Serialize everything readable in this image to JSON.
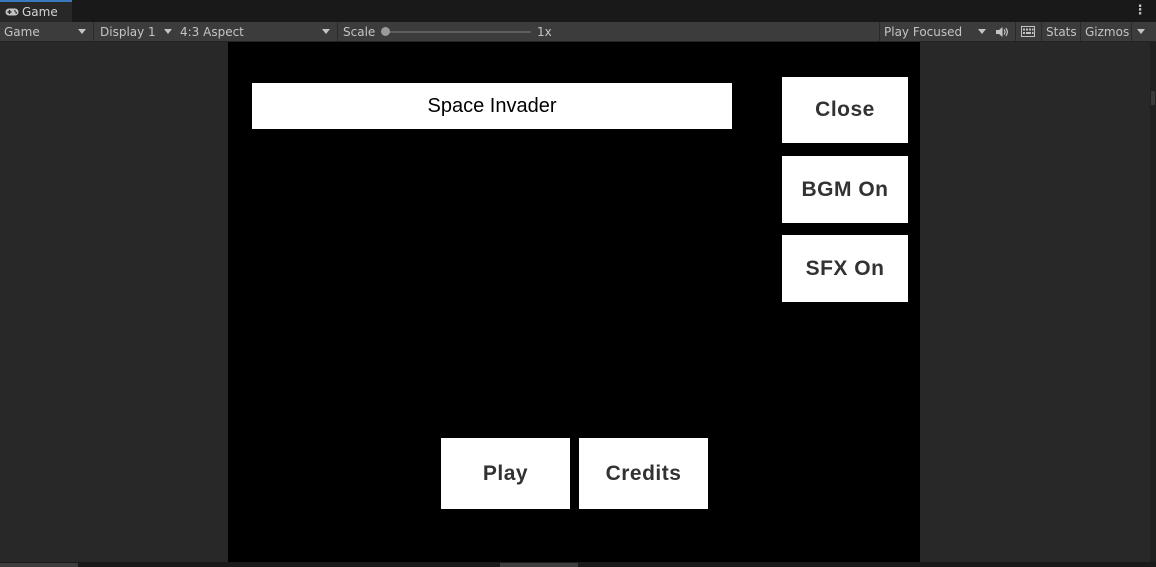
{
  "tab": {
    "label": "Game",
    "icon": "gamepad-icon"
  },
  "toolbar": {
    "view_mode": "Game",
    "display": "Display 1",
    "aspect": "4:3 Aspect",
    "scale_label": "Scale",
    "scale_value": "1x",
    "play_mode": "Play Focused",
    "stats": "Stats",
    "gizmos": "Gizmos"
  },
  "game_ui": {
    "title": "Space Invader",
    "close": "Close",
    "bgm": "BGM On",
    "sfx": "SFX On",
    "play": "Play",
    "credits": "Credits"
  },
  "colors": {
    "accent": "#3a79bb",
    "game_bg": "#000000",
    "button_bg": "#ffffff",
    "button_text": "#323232"
  }
}
